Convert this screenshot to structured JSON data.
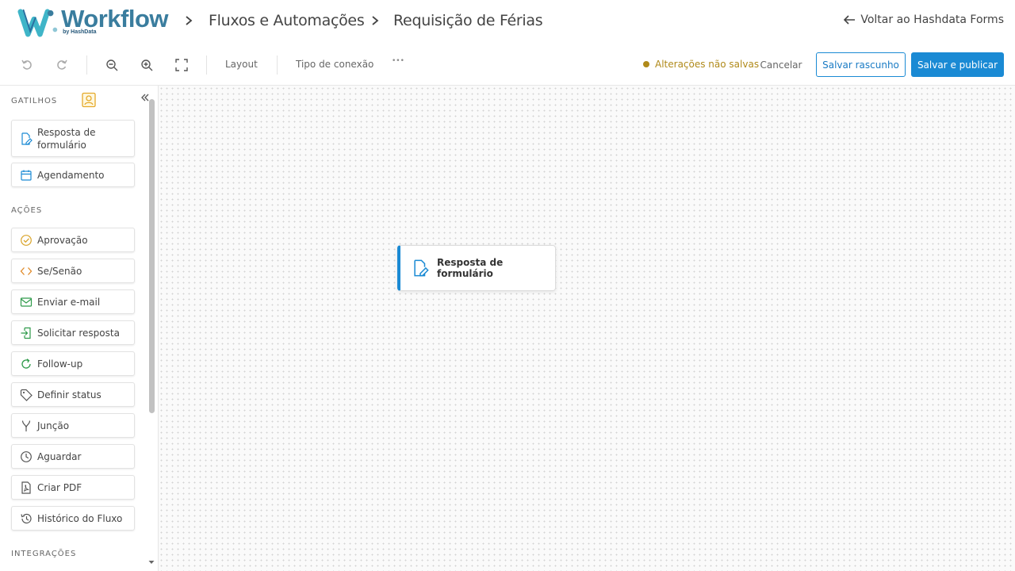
{
  "header": {
    "logo_word": "Workflow",
    "logo_sub": "by HashData",
    "breadcrumb": [
      "Fluxos e Automações",
      "Requisição de Férias"
    ],
    "back_label": "Voltar ao Hashdata Forms"
  },
  "toolbar": {
    "icons": [
      "undo-icon",
      "redo-icon",
      "zoom-out-icon",
      "zoom-in-icon",
      "fit-screen-icon"
    ],
    "layout_label": "Layout",
    "connection_label": "Tipo de conexão",
    "more_label": "•••",
    "unsaved_label": "Alterações não salvas",
    "cancel_label": "Cancelar",
    "draft_label": "Salvar rascunho",
    "publish_label": "Salvar e publicar",
    "colors": {
      "primary": "#1a8ad4",
      "warning": "#b08a1a"
    }
  },
  "sidebar": {
    "triggers_title": "GATILHOS",
    "triggers": [
      {
        "label": "Resposta de formulário",
        "icon": "form-edit-icon"
      },
      {
        "label": "Agendamento",
        "icon": "calendar-icon"
      }
    ],
    "actions_title": "AÇÕES",
    "actions": [
      {
        "label": "Aprovação",
        "icon": "check-circle-icon"
      },
      {
        "label": "Se/Senão",
        "icon": "code-brackets-icon"
      },
      {
        "label": "Enviar e-mail",
        "icon": "mail-icon"
      },
      {
        "label": "Solicitar resposta",
        "icon": "request-icon"
      },
      {
        "label": "Follow-up",
        "icon": "refresh-icon"
      },
      {
        "label": "Definir status",
        "icon": "tag-icon"
      },
      {
        "label": "Junção",
        "icon": "merge-icon"
      },
      {
        "label": "Aguardar",
        "icon": "clock-icon"
      },
      {
        "label": "Criar PDF",
        "icon": "pdf-icon"
      },
      {
        "label": "Histórico do Fluxo",
        "icon": "history-icon"
      }
    ],
    "integrations_title": "INTEGRAÇÕES"
  },
  "canvas": {
    "node": {
      "label": "Resposta de formulário",
      "icon": "form-edit-icon"
    }
  }
}
